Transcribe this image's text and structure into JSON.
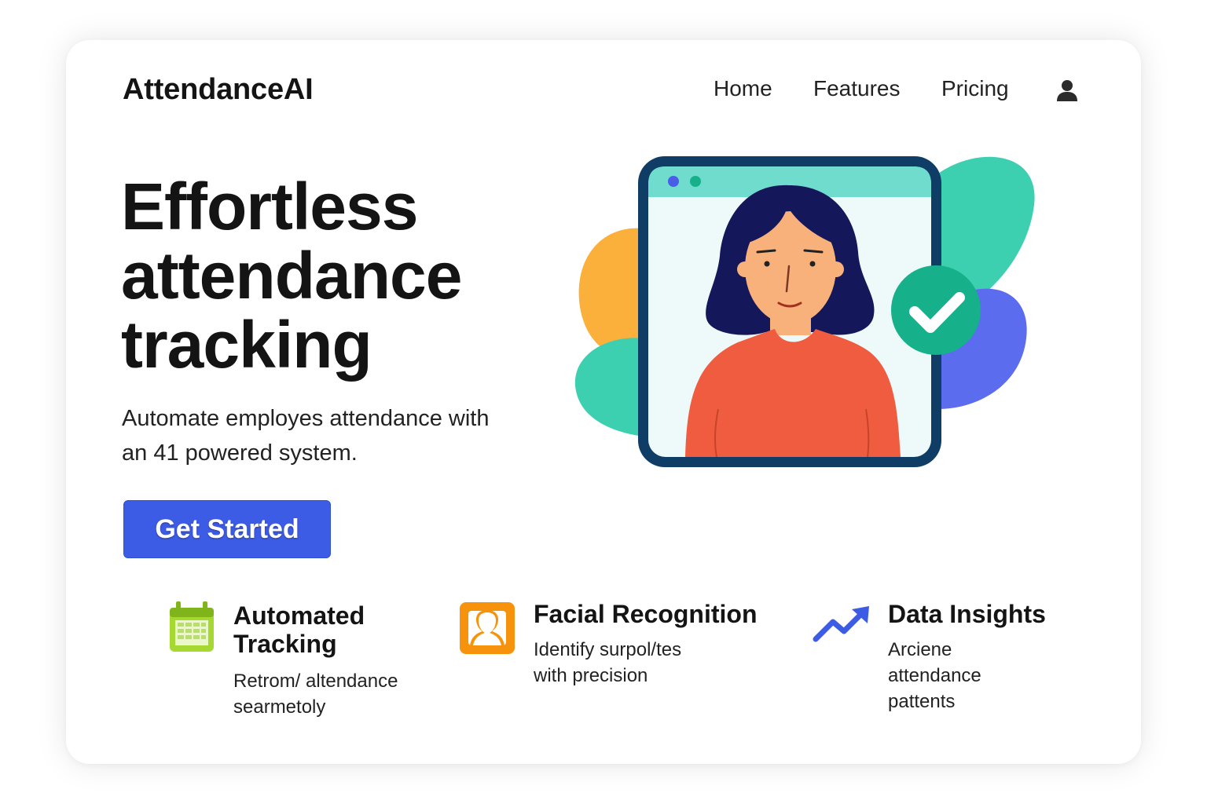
{
  "header": {
    "logo": "AttendanceAI",
    "nav": [
      "Home",
      "Features",
      "Pricing"
    ],
    "user_icon": "user-icon"
  },
  "hero": {
    "title_lines": [
      "Effortless",
      "attendance",
      "tracking"
    ],
    "subtitle_lines": [
      "Automate employes attendance with",
      "an 41 powered system."
    ],
    "cta_label": "Get Started"
  },
  "illustration": {
    "subject": "person-in-window-with-checkmark",
    "check_icon": "checkmark-badge-icon",
    "colors": {
      "frame": "#0f3d66",
      "window_bar": "#6fdccd",
      "window_bg": "#eef9f9",
      "hair": "#14185a",
      "skin": "#f8b17a",
      "shirt": "#f05c3f",
      "blob_orange": "#fbb03b",
      "blob_teal": "#3dd0b0",
      "blob_indigo": "#5c6cee",
      "check_badge": "#16b08a"
    }
  },
  "features": [
    {
      "icon": "calendar-icon",
      "title_lines": [
        "Automated",
        "Tracking"
      ],
      "desc_lines": [
        "Retrom/ altendance",
        "searmetoly"
      ]
    },
    {
      "icon": "face-frame-icon",
      "title_lines": [
        "Facial Recognition"
      ],
      "desc_lines": [
        "Identify surpol/tes",
        "with precision"
      ]
    },
    {
      "icon": "trend-arrow-icon",
      "title_lines": [
        "Data Insights"
      ],
      "desc_lines": [
        "Arciene",
        "attendance",
        "pattents"
      ]
    }
  ],
  "colors": {
    "accent": "#3d5ce6",
    "text": "#141414",
    "card_bg": "#ffffff"
  }
}
